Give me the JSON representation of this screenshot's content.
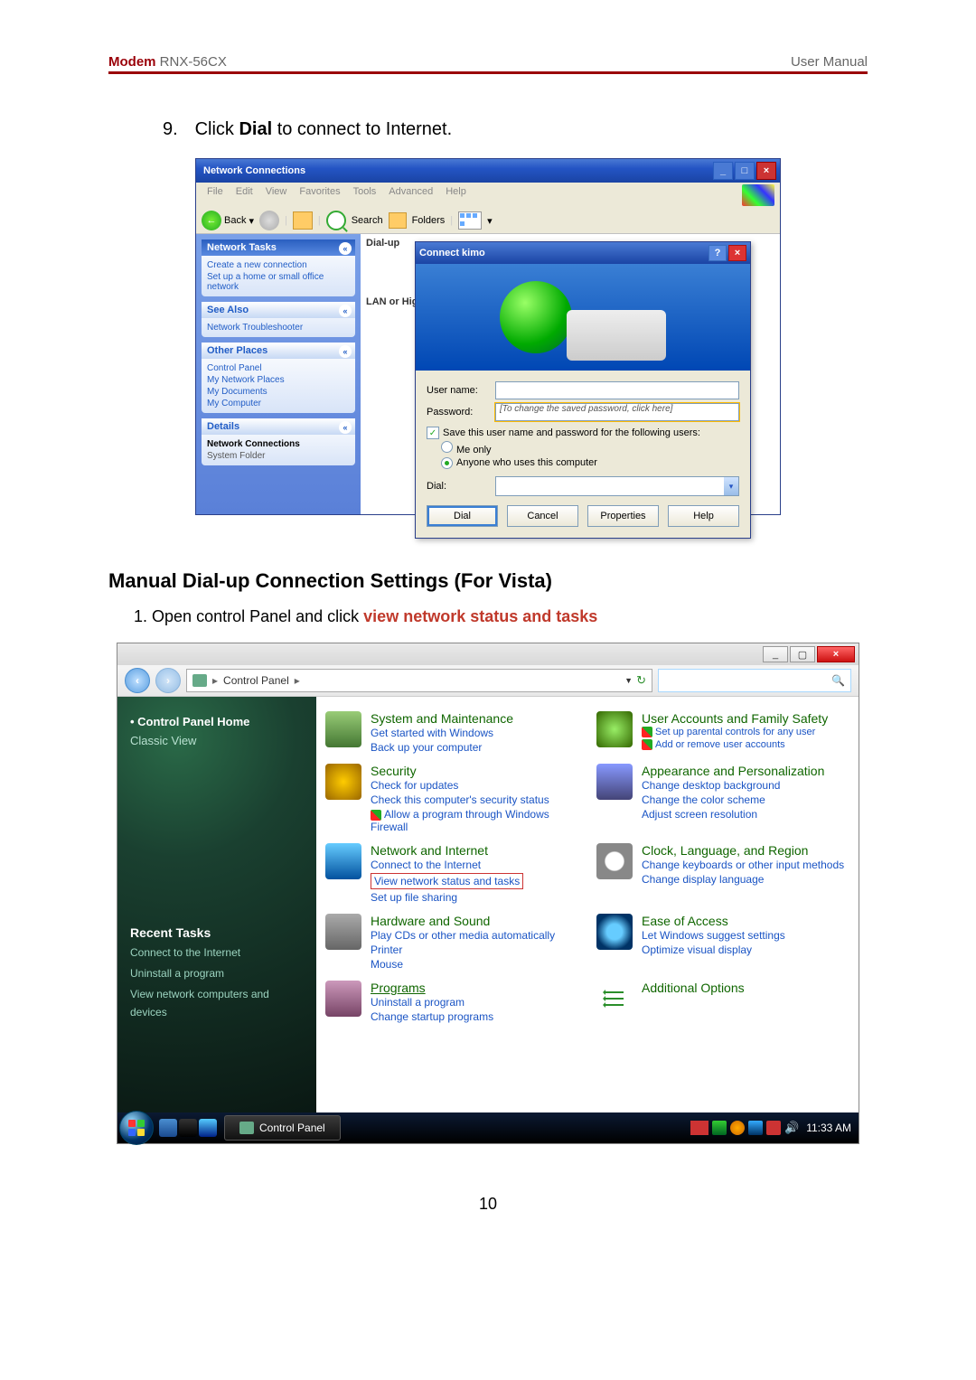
{
  "header": {
    "brand": "Modem",
    "model": "RNX-56CX",
    "right": "User Manual"
  },
  "step9": {
    "number": "9.",
    "pre": "Click ",
    "bold": "Dial",
    "post": " to connect to Internet."
  },
  "xp": {
    "window_title": "Network Connections",
    "menu": [
      "File",
      "Edit",
      "View",
      "Favorites",
      "Tools",
      "Advanced",
      "Help"
    ],
    "toolbar": {
      "back": "Back",
      "search": "Search",
      "folders": "Folders"
    },
    "sidebar": {
      "net_tasks": "Network Tasks",
      "net_tasks_items": [
        "Create a new connection",
        "Set up a home or small office network"
      ],
      "see_also": "See Also",
      "see_also_items": [
        "Network Troubleshooter"
      ],
      "other_places": "Other Places",
      "other_places_items": [
        "Control Panel",
        "My Network Places",
        "My Documents",
        "My Computer"
      ],
      "details": "Details",
      "details_items": [
        "Network Connections",
        "System Folder"
      ]
    },
    "groups": {
      "dialup": "Dial-up",
      "lan": "LAN or High-"
    },
    "dialog": {
      "title": "Connect kimo",
      "username_label": "User name:",
      "password_label": "Password:",
      "password_hint": "[To change the saved password, click here]",
      "save_check": "Save this user name and password for the following users:",
      "opt_me": "Me only",
      "opt_anyone": "Anyone who uses this computer",
      "dial_label": "Dial:",
      "btn_dial": "Dial",
      "btn_cancel": "Cancel",
      "btn_prop": "Properties",
      "btn_help": "Help"
    }
  },
  "section_heading": "Manual Dial-up Connection Settings (For Vista)",
  "substep1": {
    "num": "1.",
    "pre": "Open control Panel and click ",
    "red": "view network status and tasks"
  },
  "vista": {
    "breadcrumb": "Control Panel",
    "sidebar": {
      "home": "Control Panel Home",
      "classic": "Classic View",
      "recent": "Recent Tasks",
      "tasks": [
        "Connect to the Internet",
        "Uninstall a program",
        "View network computers and devices"
      ]
    },
    "cats": {
      "sys_title": "System and Maintenance",
      "sys_links": [
        "Get started with Windows",
        "Back up your computer"
      ],
      "sec_title": "Security",
      "sec_links": [
        "Check for updates",
        "Check this computer's security status",
        "Allow a program through Windows Firewall"
      ],
      "net_title": "Network and Internet",
      "net_links": [
        "Connect to the Internet",
        "View network status and tasks",
        "Set up file sharing"
      ],
      "hw_title": "Hardware and Sound",
      "hw_links": [
        "Play CDs or other media automatically",
        "Printer",
        "Mouse"
      ],
      "prog_title": "Programs",
      "prog_links": [
        "Uninstall a program",
        "Change startup programs"
      ],
      "user_title": "User Accounts and Family Safety",
      "user_links": [
        "Set up parental controls for any user",
        "Add or remove user accounts"
      ],
      "app_title": "Appearance and Personalization",
      "app_links": [
        "Change desktop background",
        "Change the color scheme",
        "Adjust screen resolution"
      ],
      "clock_title": "Clock, Language, and Region",
      "clock_links": [
        "Change keyboards or other input methods",
        "Change display language"
      ],
      "ease_title": "Ease of Access",
      "ease_links": [
        "Let Windows suggest settings",
        "Optimize visual display"
      ],
      "addl_title": "Additional Options"
    },
    "taskbar": {
      "active": "Control Panel",
      "time": "11:33 AM"
    }
  },
  "page_number": "10"
}
